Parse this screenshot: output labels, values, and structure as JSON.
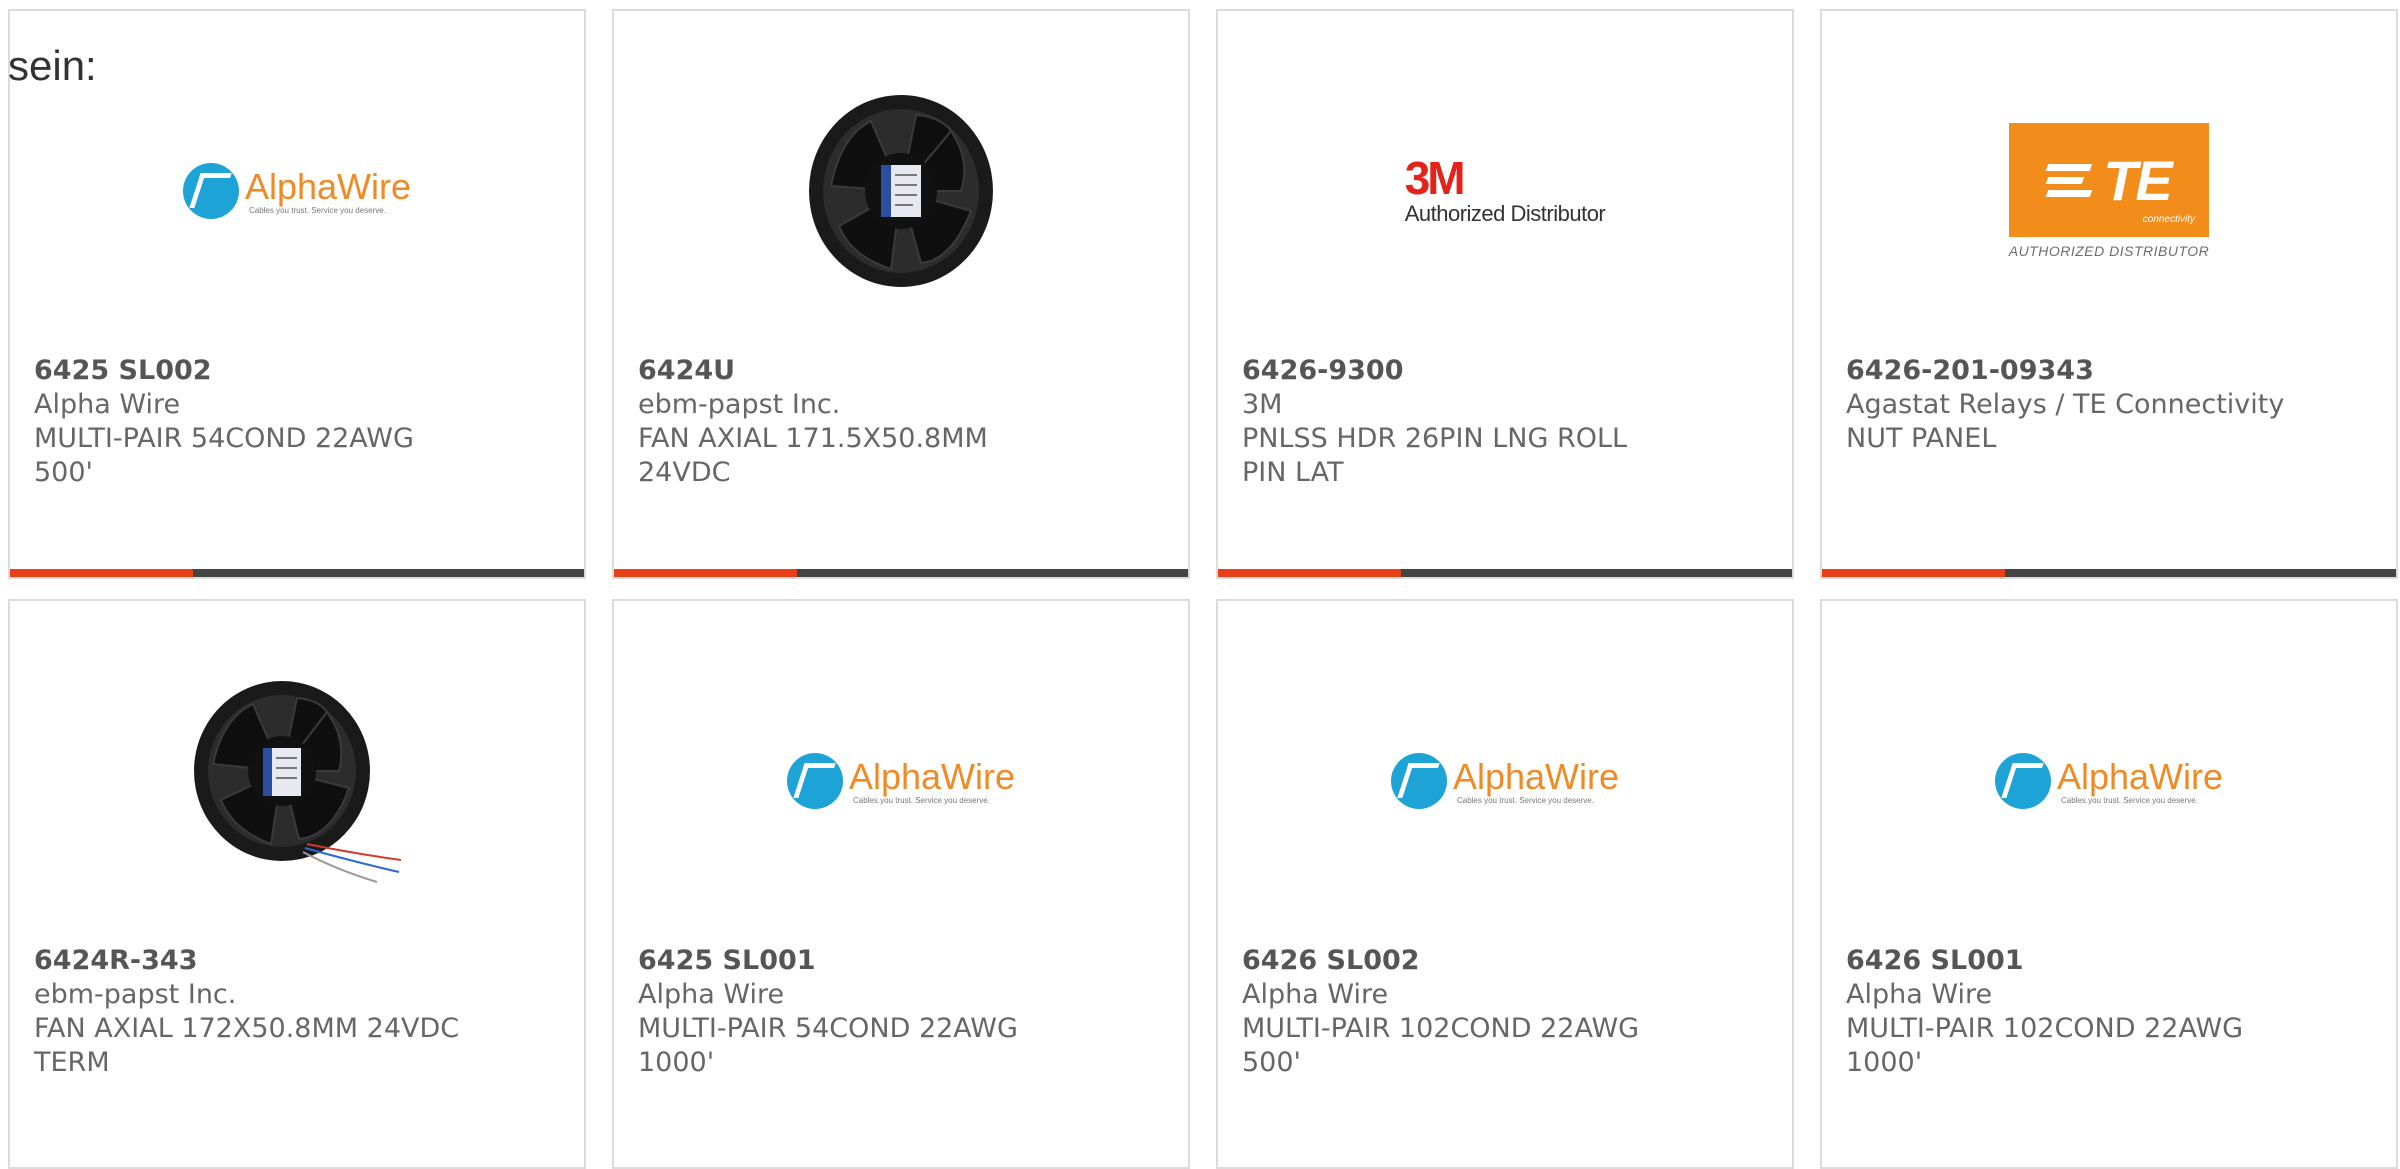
{
  "intro_text": "sein:",
  "cards": [
    {
      "part_number": "6425 SL002",
      "manufacturer": "Alpha Wire",
      "description": "MULTI-PAIR 54COND 22AWG 500'",
      "image": "alphawire-logo"
    },
    {
      "part_number": "6424U",
      "manufacturer": "ebm-papst Inc.",
      "description": "FAN AXIAL 171.5X50.8MM 24VDC",
      "image": "axial-fan-photo"
    },
    {
      "part_number": "6426-9300",
      "manufacturer": "3M",
      "description": "PNLSS HDR 26PIN LNG ROLL PIN LAT",
      "image": "3m-authorized-distributor-logo"
    },
    {
      "part_number": "6426-201-09343",
      "manufacturer": "Agastat Relays / TE Connectivity",
      "description": "NUT PANEL",
      "image": "te-connectivity-logo"
    },
    {
      "part_number": "6424R-343",
      "manufacturer": "ebm-papst Inc.",
      "description": "FAN AXIAL 172X50.8MM 24VDC TERM",
      "image": "axial-fan-wires-photo"
    },
    {
      "part_number": "6425 SL001",
      "manufacturer": "Alpha Wire",
      "description": "MULTI-PAIR 54COND 22AWG 1000'",
      "image": "alphawire-logo"
    },
    {
      "part_number": "6426 SL002",
      "manufacturer": "Alpha Wire",
      "description": "MULTI-PAIR 102COND 22AWG 500'",
      "image": "alphawire-logo"
    },
    {
      "part_number": "6426 SL001",
      "manufacturer": "Alpha Wire",
      "description": "MULTI-PAIR 102COND 22AWG 1000'",
      "image": "alphawire-logo"
    }
  ],
  "logos": {
    "alphawire": {
      "name": "AlphaWire",
      "tagline": "Cables you trust. Service you deserve."
    },
    "mmm": {
      "mark": "3M",
      "caption": "Authorized Distributor"
    },
    "te": {
      "mark": "TE",
      "sub": "connectivity",
      "caption": "AUTHORIZED DISTRIBUTOR"
    }
  },
  "colors": {
    "accent_bar": "#e8411a",
    "dark_bar": "#444444",
    "border": "#dcdcdc",
    "alphawire_blue": "#1ea3d6",
    "alphawire_orange": "#f08a24",
    "te_orange": "#f28c1b",
    "mmm_red": "#e2231a"
  }
}
